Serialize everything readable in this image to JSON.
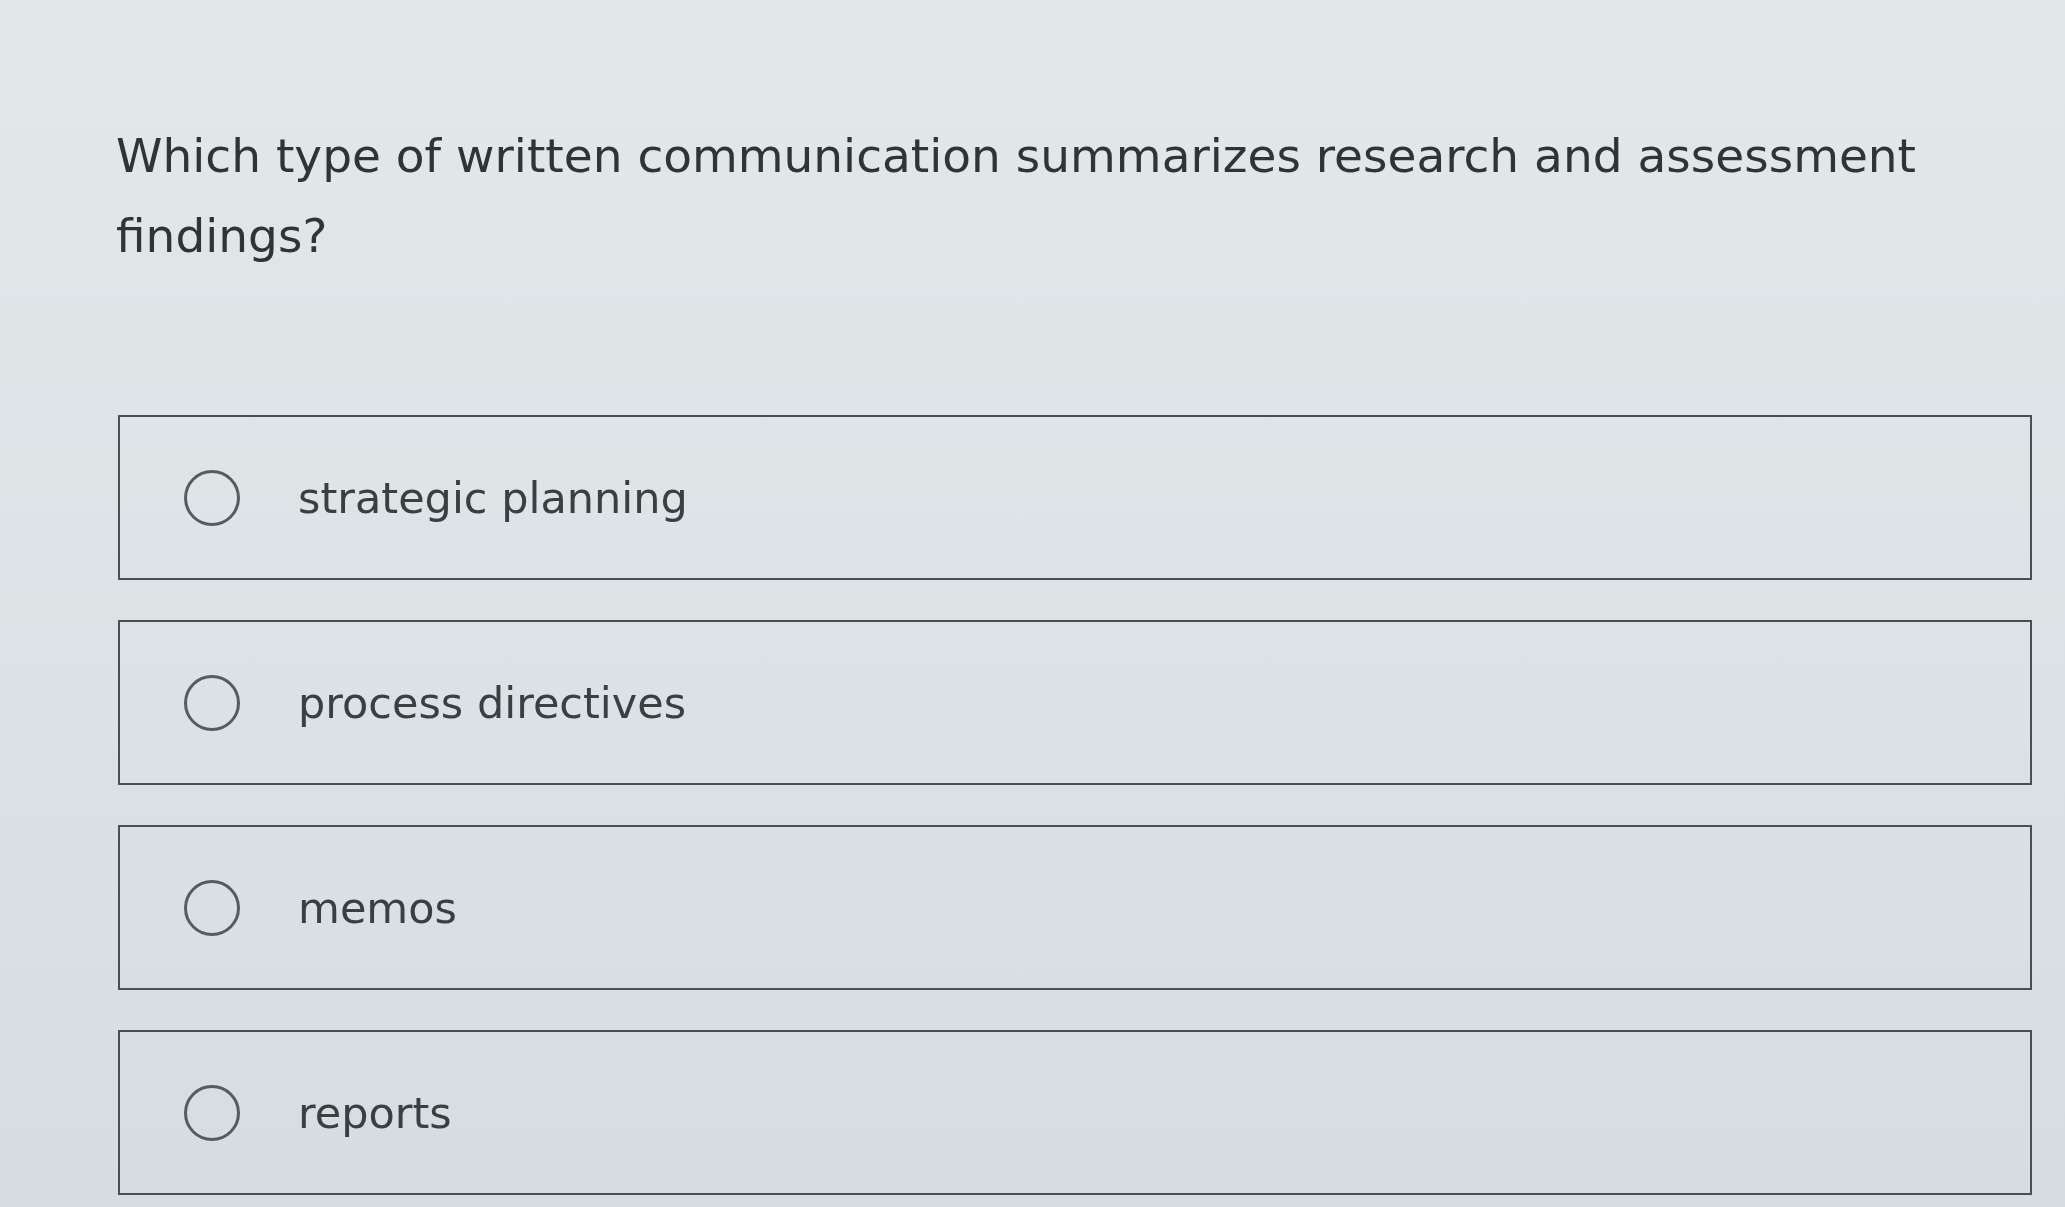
{
  "question": "Which type of written communication summarizes research and assessment findings?",
  "options": [
    {
      "label": "strategic planning",
      "selected": false
    },
    {
      "label": "process directives",
      "selected": false
    },
    {
      "label": "memos",
      "selected": false
    },
    {
      "label": "reports",
      "selected": false
    }
  ]
}
